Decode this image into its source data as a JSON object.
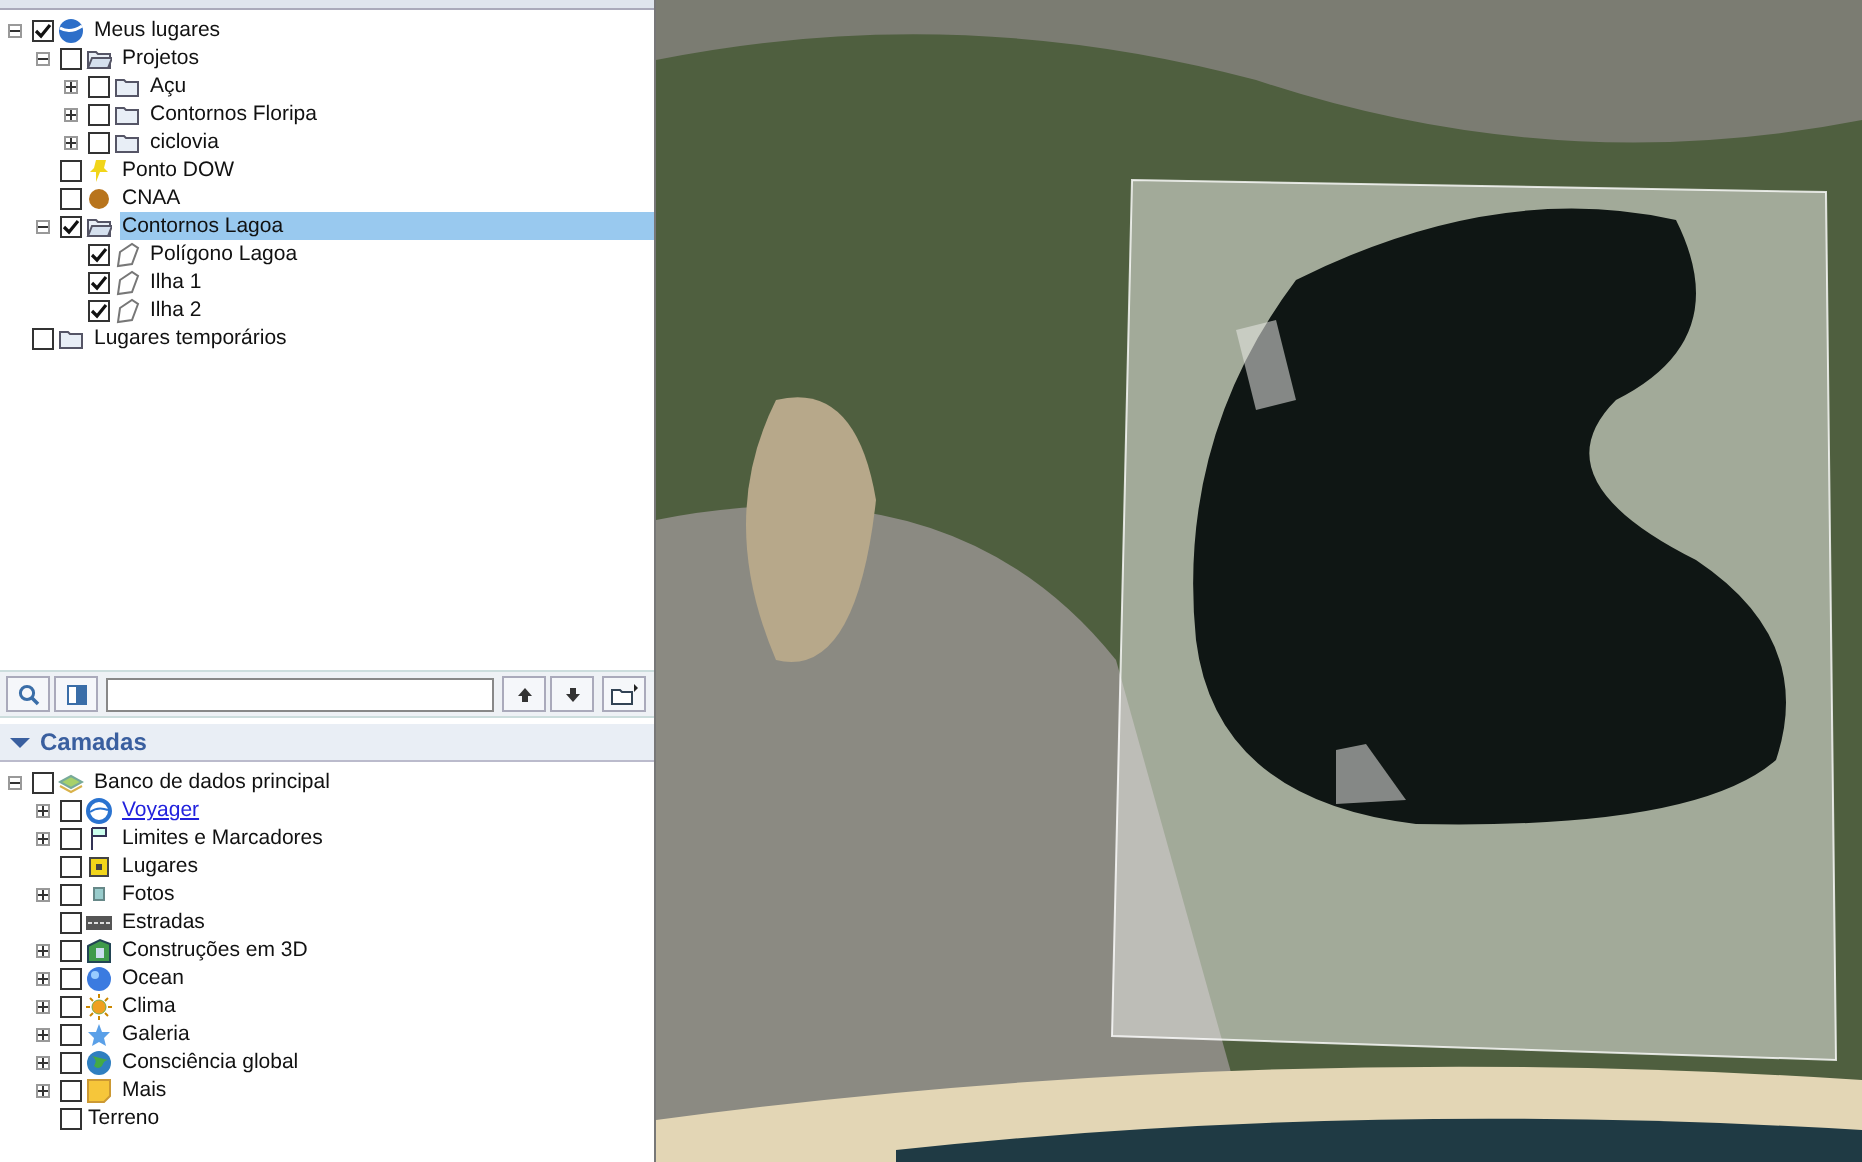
{
  "places": {
    "items": [
      {
        "label": "Meus lugares",
        "kind": "globe",
        "checked": true,
        "expanded": true,
        "selected": false,
        "children": [
          {
            "label": "Projetos",
            "kind": "openfolder",
            "checked": false,
            "expanded": true,
            "selected": false,
            "children": [
              {
                "label": "Açu",
                "kind": "folder",
                "checked": false,
                "expanded": false,
                "selected": false
              },
              {
                "label": "Contornos Floripa",
                "kind": "folder",
                "checked": false,
                "expanded": false,
                "selected": false
              },
              {
                "label": "ciclovia",
                "kind": "folder",
                "checked": false,
                "expanded": false,
                "selected": false
              }
            ]
          },
          {
            "label": "Ponto DOW",
            "kind": "pin",
            "checked": false,
            "selected": false
          },
          {
            "label": "CNAA",
            "kind": "dot",
            "checked": false,
            "selected": false
          },
          {
            "label": "Contornos Lagoa",
            "kind": "openfolder",
            "checked": true,
            "expanded": true,
            "selected": true,
            "children": [
              {
                "label": "Polígono Lagoa",
                "kind": "polygon",
                "checked": true,
                "selected": false
              },
              {
                "label": "Ilha 1",
                "kind": "polygon",
                "checked": true,
                "selected": false
              },
              {
                "label": "Ilha 2",
                "kind": "polygon",
                "checked": true,
                "selected": false
              }
            ]
          }
        ]
      },
      {
        "label": "Lugares temporários",
        "kind": "folder",
        "checked": false,
        "selected": false
      }
    ]
  },
  "layers": {
    "title": "Camadas",
    "expanded": true,
    "items": [
      {
        "label": "Banco de dados principal",
        "kind": "database",
        "checked": false,
        "expanded": true,
        "link": false,
        "children": [
          {
            "label": "Voyager",
            "kind": "ring",
            "checked": false,
            "expanded": false,
            "link": true
          },
          {
            "label": "Limites e Marcadores",
            "kind": "flag",
            "checked": false,
            "expanded": false,
            "link": false
          },
          {
            "label": "Lugares",
            "kind": "square",
            "checked": false,
            "link": false
          },
          {
            "label": "Fotos",
            "kind": "photo",
            "checked": false,
            "expanded": false,
            "link": false
          },
          {
            "label": "Estradas",
            "kind": "road",
            "checked": false,
            "link": false
          },
          {
            "label": "Construções em 3D",
            "kind": "building",
            "checked": false,
            "expanded": false,
            "link": false
          },
          {
            "label": "Ocean",
            "kind": "sphere",
            "checked": false,
            "expanded": false,
            "link": false
          },
          {
            "label": "Clima",
            "kind": "sun",
            "checked": false,
            "expanded": false,
            "link": false
          },
          {
            "label": "Galeria",
            "kind": "star",
            "checked": false,
            "expanded": false,
            "link": false
          },
          {
            "label": "Consciência global",
            "kind": "earth",
            "checked": false,
            "expanded": false,
            "link": false
          },
          {
            "label": "Mais",
            "kind": "note",
            "checked": false,
            "expanded": false,
            "link": false
          },
          {
            "label": "Terreno",
            "kind": "plain",
            "checked": false,
            "link": false
          }
        ]
      }
    ]
  }
}
